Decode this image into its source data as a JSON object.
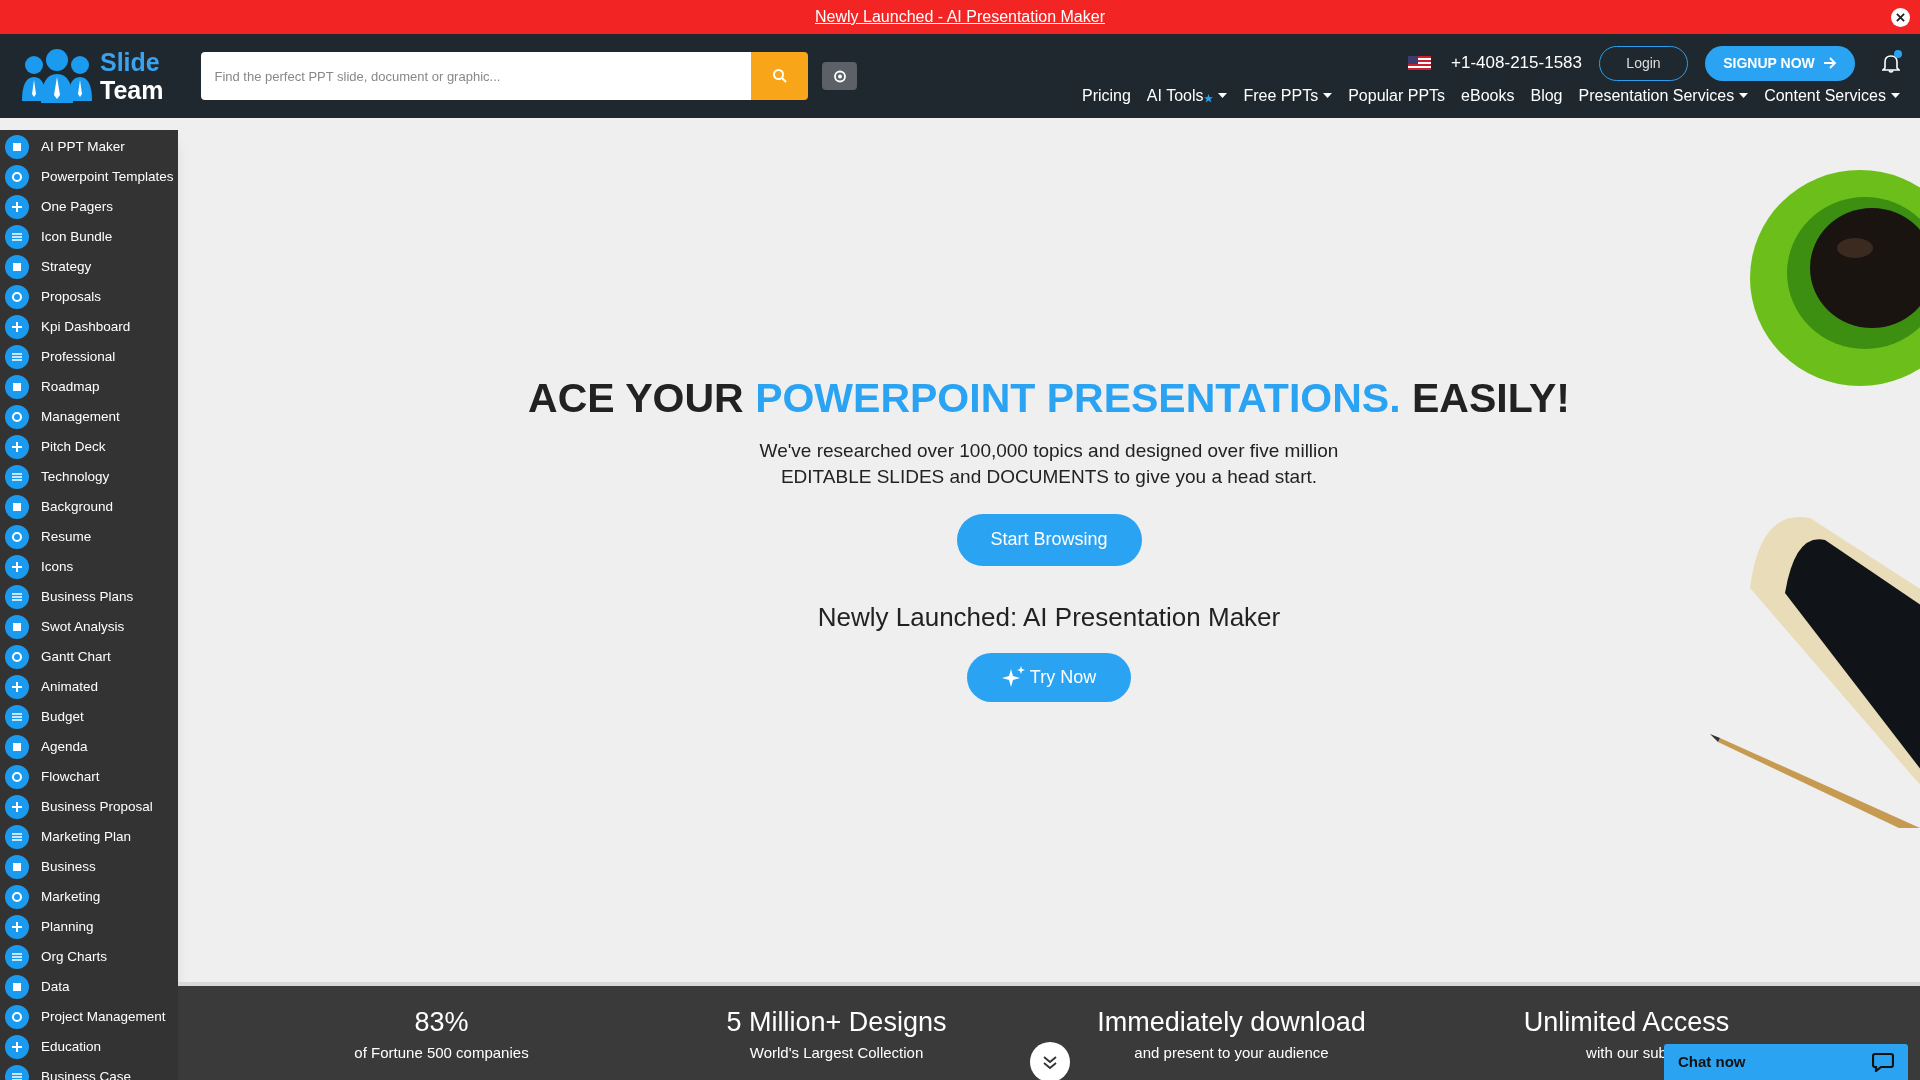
{
  "announcement": {
    "link": "Newly Launched - AI Presentation Maker"
  },
  "header": {
    "logo": {
      "line_1": "Slide",
      "line_2": "Team"
    },
    "search": {
      "placeholder": "Find the perfect PPT slide, document or graphic..."
    },
    "phone": "+1-408-215-1583",
    "login": "Login",
    "signup": "SIGNUP NOW",
    "notification_dot": true
  },
  "nav": [
    {
      "label": "Pricing",
      "dropdown": false,
      "star": false
    },
    {
      "label": "AI Tools",
      "dropdown": true,
      "star": true
    },
    {
      "label": "Free PPTs",
      "dropdown": true,
      "star": false
    },
    {
      "label": "Popular PPTs",
      "dropdown": false,
      "star": false
    },
    {
      "label": "eBooks",
      "dropdown": false,
      "star": false
    },
    {
      "label": "Blog",
      "dropdown": false,
      "star": false
    },
    {
      "label": "Presentation Services",
      "dropdown": true,
      "star": false
    },
    {
      "label": "Content Services",
      "dropdown": true,
      "star": false
    }
  ],
  "sidebar": {
    "items": [
      "AI PPT Maker",
      "Powerpoint Templates",
      "One Pagers",
      "Icon Bundle",
      "Strategy",
      "Proposals",
      "Kpi Dashboard",
      "Professional",
      "Roadmap",
      "Management",
      "Pitch Deck",
      "Technology",
      "Background",
      "Resume",
      "Icons",
      "Business Plans",
      "Swot Analysis",
      "Gantt Chart",
      "Animated",
      "Budget",
      "Agenda",
      "Flowchart",
      "Business Proposal",
      "Marketing Plan",
      "Business",
      "Marketing",
      "Planning",
      "Org Charts",
      "Data",
      "Project Management",
      "Education",
      "Business Case"
    ]
  },
  "hero": {
    "heading_start": "ACE YOUR ",
    "heading_highlight": "POWERPOINT PRESENTATIONS.",
    "heading_end": " EASILY!",
    "text_line_1": "We've researched over 100,000 topics and designed over five million",
    "text_line_2": "EDITABLE SLIDES and DOCUMENTS to give you a head start.",
    "primary_button": "Start Browsing",
    "subheading": "Newly Launched: AI Presentation Maker",
    "secondary_button": "Try Now"
  },
  "stats": [
    {
      "title": "83%",
      "subtitle": "of Fortune 500 companies"
    },
    {
      "title": "5 Million+ Designs",
      "subtitle": "World's Largest Collection"
    },
    {
      "title": "Immediately download",
      "subtitle": "and present to your audience"
    },
    {
      "title": "Unlimited Access",
      "subtitle": "with our sub"
    }
  ],
  "chat": {
    "label": "Chat now"
  }
}
